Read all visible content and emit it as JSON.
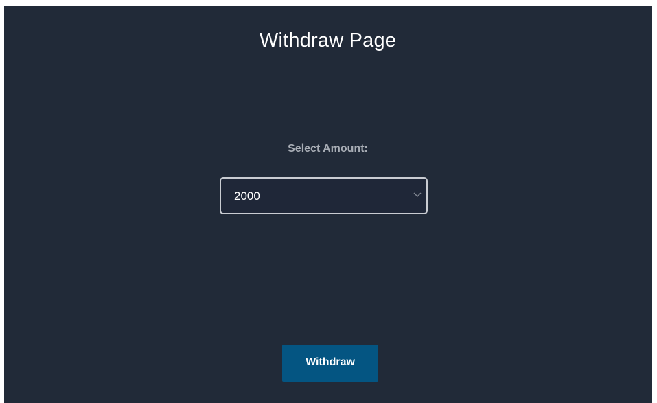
{
  "page": {
    "title": "Withdraw Page"
  },
  "form": {
    "amount_label": "Select Amount:",
    "amount_selected": "2000",
    "amount_chevron_icon": "chevron-down-icon"
  },
  "actions": {
    "withdraw_label": "Withdraw"
  },
  "colors": {
    "panel_background": "#212a38",
    "select_border": "#c9ccd2",
    "label_text": "#a8adb5",
    "button_background": "#045582"
  }
}
